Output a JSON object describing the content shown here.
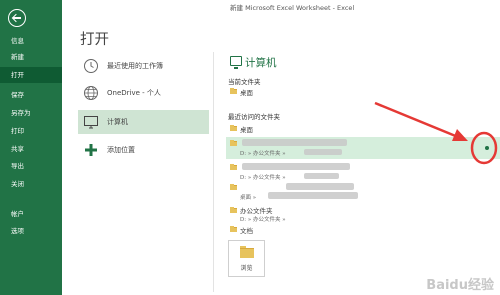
{
  "window": {
    "title": "新建 Microsoft Excel Worksheet - Excel"
  },
  "nav": {
    "back_icon": "back-arrow-icon",
    "items": [
      {
        "label": "信息"
      },
      {
        "label": "新建"
      },
      {
        "label": "打开"
      },
      {
        "label": "保存"
      },
      {
        "label": "另存为"
      },
      {
        "label": "打印"
      },
      {
        "label": "共享"
      },
      {
        "label": "导出"
      },
      {
        "label": "关闭"
      },
      {
        "label": "帐户"
      },
      {
        "label": "选项"
      }
    ],
    "active_index": 2
  },
  "page": {
    "title": "打开"
  },
  "places": {
    "items": [
      {
        "label": "最近使用的工作簿",
        "icon": "clock-icon"
      },
      {
        "label": "OneDrive - 个人",
        "icon": "globe-icon"
      },
      {
        "label": "计算机",
        "icon": "computer-icon"
      },
      {
        "label": "添加位置",
        "icon": "plus-icon"
      }
    ],
    "active_index": 2
  },
  "computer": {
    "title": "计算机",
    "current_folder_header": "当前文件夹",
    "current_folder": {
      "name": "桌面"
    },
    "recent_header": "最近访问的文件夹",
    "recent_folders": [
      {
        "name": "桌面",
        "path": ""
      },
      {
        "name": "",
        "path": "D: » 办公文件夹 »"
      },
      {
        "name": "",
        "path": "D: » 办公文件夹 »"
      },
      {
        "name": "",
        "path": "桌面 »"
      },
      {
        "name": "办公文件夹",
        "path": "D: » 办公文件夹 »"
      },
      {
        "name": "文档",
        "path": ""
      }
    ],
    "browse": {
      "label": "浏览",
      "icon": "open-folder-icon"
    }
  },
  "colors": {
    "accent": "#217346",
    "selected": "#cfe4d3",
    "highlight": "#d5eedc",
    "annotation": "#e53935"
  },
  "watermark": {
    "text": "Baidu经验"
  }
}
